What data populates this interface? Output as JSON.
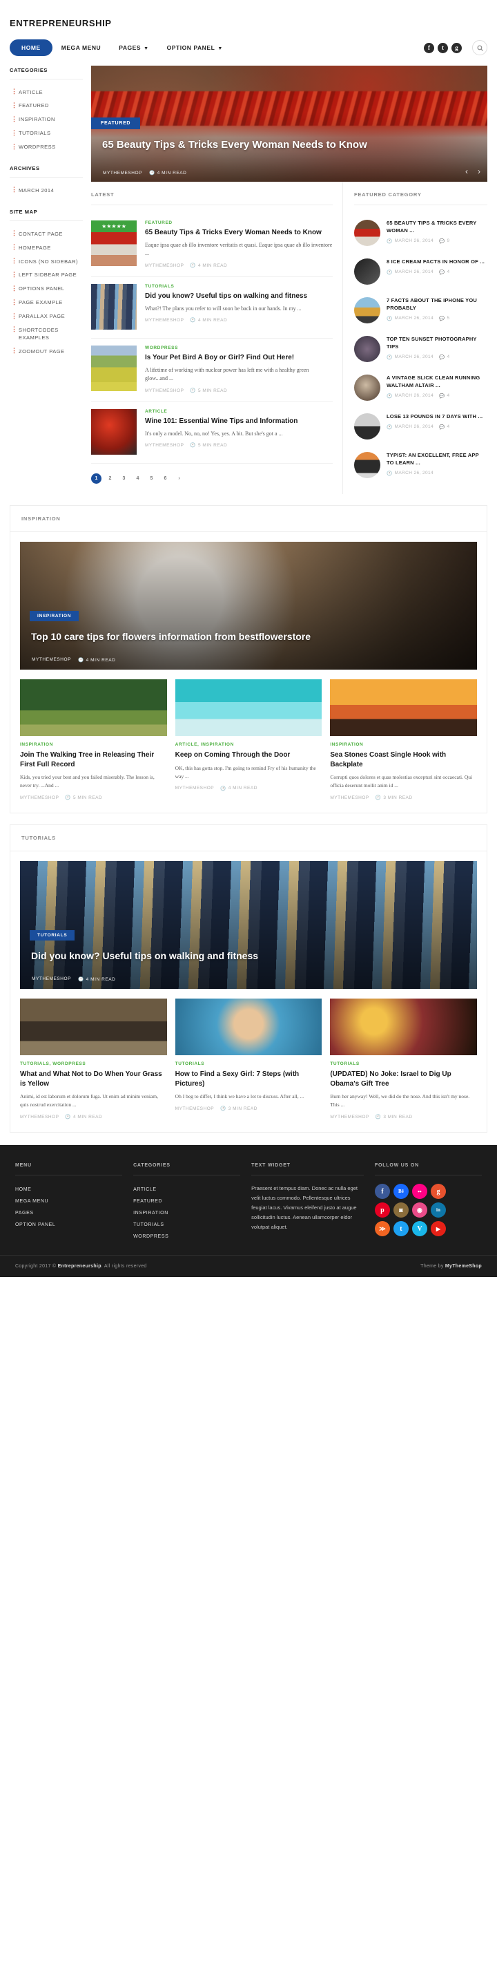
{
  "site": {
    "title": "ENTREPRENEURSHIP"
  },
  "nav": {
    "items": [
      {
        "label": "HOME",
        "active": true,
        "caret": false
      },
      {
        "label": "MEGA MENU",
        "active": false,
        "caret": false
      },
      {
        "label": "PAGES",
        "active": false,
        "caret": true
      },
      {
        "label": "OPTION PANEL",
        "active": false,
        "caret": true
      }
    ],
    "social": [
      {
        "name": "facebook-icon",
        "glyph": "f"
      },
      {
        "name": "twitter-icon",
        "glyph": "t"
      },
      {
        "name": "googleplus-icon",
        "glyph": "g"
      }
    ],
    "search_label": "search-icon"
  },
  "sidebar": {
    "categories_heading": "CATEGORIES",
    "categories": [
      "ARTICLE",
      "FEATURED",
      "INSPIRATION",
      "TUTORIALS",
      "WORDPRESS"
    ],
    "archives_heading": "ARCHIVES",
    "archives": [
      "MARCH 2014"
    ],
    "sitemap_heading": "SITE MAP",
    "sitemap": [
      "CONTACT PAGE",
      "HOMEPAGE",
      "ICONS (NO SIDEBAR)",
      "LEFT SIDBEAR PAGE",
      "OPTIONS PANEL",
      "PAGE EXAMPLE",
      "PARALLAX PAGE",
      "SHORTCODES EXAMPLES",
      "ZOOMOUT PAGE"
    ]
  },
  "hero": {
    "badge": "FEATURED",
    "title": "65 Beauty Tips & Tricks Every Woman Needs to Know",
    "author": "MYTHEMESHOP",
    "read_time": "4 MIN READ",
    "prev": "‹",
    "next": "›"
  },
  "latest": {
    "heading": "LATEST",
    "posts": [
      {
        "category": "FEATURED",
        "title": "65 Beauty Tips & Tricks Every Woman Needs to Know",
        "excerpt": "Eaque ipsa quae ab illo inventore veritatis et quasi. Eaque ipsa quae ab illo inventore ...",
        "author": "MYTHEMESHOP",
        "read_time": "4 MIN READ",
        "rating": "★★★★★"
      },
      {
        "category": "TUTORIALS",
        "title": "Did you know? Useful tips on walking and fitness",
        "excerpt": "What?! The plans you refer to will soon be back in our hands. In my ...",
        "author": "MYTHEMESHOP",
        "read_time": "4 MIN READ",
        "rating": ""
      },
      {
        "category": "WORDPRESS",
        "title": "Is Your Pet Bird A Boy or Girl? Find Out Here!",
        "excerpt": "A lifetime of working with nuclear power has left me with a healthy green glow...and ...",
        "author": "MYTHEMESHOP",
        "read_time": "5 MIN READ",
        "rating": ""
      },
      {
        "category": "ARTICLE",
        "title": "Wine 101: Essential Wine Tips and Information",
        "excerpt": "It's only a model. No, no, no! Yes, yes. A bit. But she's got a ...",
        "author": "MYTHEMESHOP",
        "read_time": "5 MIN READ",
        "rating": ""
      }
    ],
    "pagination": [
      "1",
      "2",
      "3",
      "4",
      "5",
      "6",
      "›"
    ]
  },
  "featured_category": {
    "heading": "FEATURED CATEGORY",
    "items": [
      {
        "title": "65 BEAUTY TIPS & TRICKS EVERY WOMAN ...",
        "date": "MARCH 26, 2014",
        "comments": "9"
      },
      {
        "title": "8 ICE CREAM FACTS IN HONOR OF ...",
        "date": "MARCH 26, 2014",
        "comments": "4"
      },
      {
        "title": "7 FACTS ABOUT THE IPHONE YOU PROBABLY",
        "date": "MARCH 26, 2014",
        "comments": "5"
      },
      {
        "title": "TOP TEN SUNSET PHOTOGRAPHY TIPS",
        "date": "MARCH 26, 2014",
        "comments": "4"
      },
      {
        "title": "A VINTAGE SLICK CLEAN RUNNING WALTHAM ALTAIR ...",
        "date": "MARCH 26, 2014",
        "comments": "4"
      },
      {
        "title": "LOSE 13 POUNDS IN 7 DAYS WITH ...",
        "date": "MARCH 26, 2014",
        "comments": "4"
      },
      {
        "title": "TYPIST: AN EXCELLENT, FREE APP TO LEARN ...",
        "date": "MARCH 26, 2014",
        "comments": ""
      }
    ]
  },
  "inspiration": {
    "heading": "INSPIRATION",
    "hero": {
      "badge": "INSPIRATION",
      "title": "Top 10 care tips for flowers information from bestflowerstore",
      "author": "MYTHEMESHOP",
      "read_time": "4 MIN READ"
    },
    "cards": [
      {
        "category": "INSPIRATION",
        "title": "Join The Walking Tree in Releasing Their First Full Record",
        "excerpt": "Kids, you tried your best and you failed miserably. The lesson is, never try. ...And ...",
        "author": "MYTHEMESHOP",
        "read_time": "5 MIN READ"
      },
      {
        "category": "ARTICLE, INSPIRATION",
        "title": "Keep on Coming Through the Door",
        "excerpt": "OK, this has gotta stop. I'm going to remind Fry of his humanity the way ...",
        "author": "MYTHEMESHOP",
        "read_time": "4 MIN READ"
      },
      {
        "category": "INSPIRATION",
        "title": "Sea Stones Coast Single Hook with Backplate",
        "excerpt": "Corrupti quos dolores et quas molestias excepturi sint occaecati. Qui officia deserunt mollit anim id ...",
        "author": "MYTHEMESHOP",
        "read_time": "3 MIN READ"
      }
    ]
  },
  "tutorials": {
    "heading": "TUTORIALS",
    "hero": {
      "badge": "TUTORIALS",
      "title": "Did you know? Useful tips on walking and fitness",
      "author": "MYTHEMESHOP",
      "read_time": "4 MIN READ"
    },
    "cards": [
      {
        "category": "TUTORIALS, WORDPRESS",
        "title": "What and What Not to Do When Your Grass is Yellow",
        "excerpt": "Animi, id est laborum et dolorum fuga. Ut enim ad minim veniam, quis nostrud exercitation ...",
        "author": "MYTHEMESHOP",
        "read_time": "4 MIN READ"
      },
      {
        "category": "TUTORIALS",
        "title": "How to Find a Sexy Girl: 7 Steps (with Pictures)",
        "excerpt": "Oh I beg to differ, I think we have a lot to discuss. After all, ...",
        "author": "MYTHEMESHOP",
        "read_time": "3 MIN READ"
      },
      {
        "category": "TUTORIALS",
        "title": "(UPDATED) No Joke: Israel to Dig Up Obama's Gift Tree",
        "excerpt": "Burn her anyway! Well, we did do the nose. And this isn't my nose. This ...",
        "author": "MYTHEMESHOP",
        "read_time": "3 MIN READ"
      }
    ]
  },
  "footer": {
    "menu_heading": "MENU",
    "menu": [
      "HOME",
      "MEGA MENU",
      "PAGES",
      "OPTION PANEL"
    ],
    "categories_heading": "CATEGORIES",
    "categories": [
      "ARTICLE",
      "FEATURED",
      "INSPIRATION",
      "TUTORIALS",
      "WORDPRESS"
    ],
    "text_heading": "TEXT WIDGET",
    "text": "Praesent et tempus diam. Donec ac nulla eget velit luctus commodo. Pellentesque ultrices feugiat lacus. Vivamus eleifend justo at augue sollicitudin luctus. Aenean ullamcorper eldor volutpat aliquet.",
    "follow_heading": "FOLLOW US ON",
    "social": [
      {
        "name": "facebook-icon",
        "glyph": "f",
        "color": "#3b5998"
      },
      {
        "name": "behance-icon",
        "glyph": "Bē",
        "color": "#1769ff"
      },
      {
        "name": "flickr-icon",
        "glyph": "••",
        "color": "#ff0084"
      },
      {
        "name": "googleplus-icon",
        "glyph": "g",
        "color": "#e8522e"
      },
      {
        "name": "pinterest-icon",
        "glyph": "p",
        "color": "#e60023"
      },
      {
        "name": "instagram-icon",
        "glyph": "◙",
        "color": "#8a6d3b"
      },
      {
        "name": "dribbble-icon",
        "glyph": "◉",
        "color": "#ea4c89"
      },
      {
        "name": "linkedin-icon",
        "glyph": "in",
        "color": "#0e76a8"
      },
      {
        "name": "rss-icon",
        "glyph": "≫",
        "color": "#f26522"
      },
      {
        "name": "twitter-icon",
        "glyph": "t",
        "color": "#1da1f2"
      },
      {
        "name": "vimeo-icon",
        "glyph": "V",
        "color": "#1ab7ea"
      },
      {
        "name": "youtube-icon",
        "glyph": "▶",
        "color": "#e62117"
      }
    ]
  },
  "copyright": {
    "left_pre": "Copyright 2017 © ",
    "left_brand": "Entrepreneurship",
    "left_post": ". All rights reserved",
    "right_pre": "Theme by ",
    "right_brand": "MyThemeShop"
  }
}
